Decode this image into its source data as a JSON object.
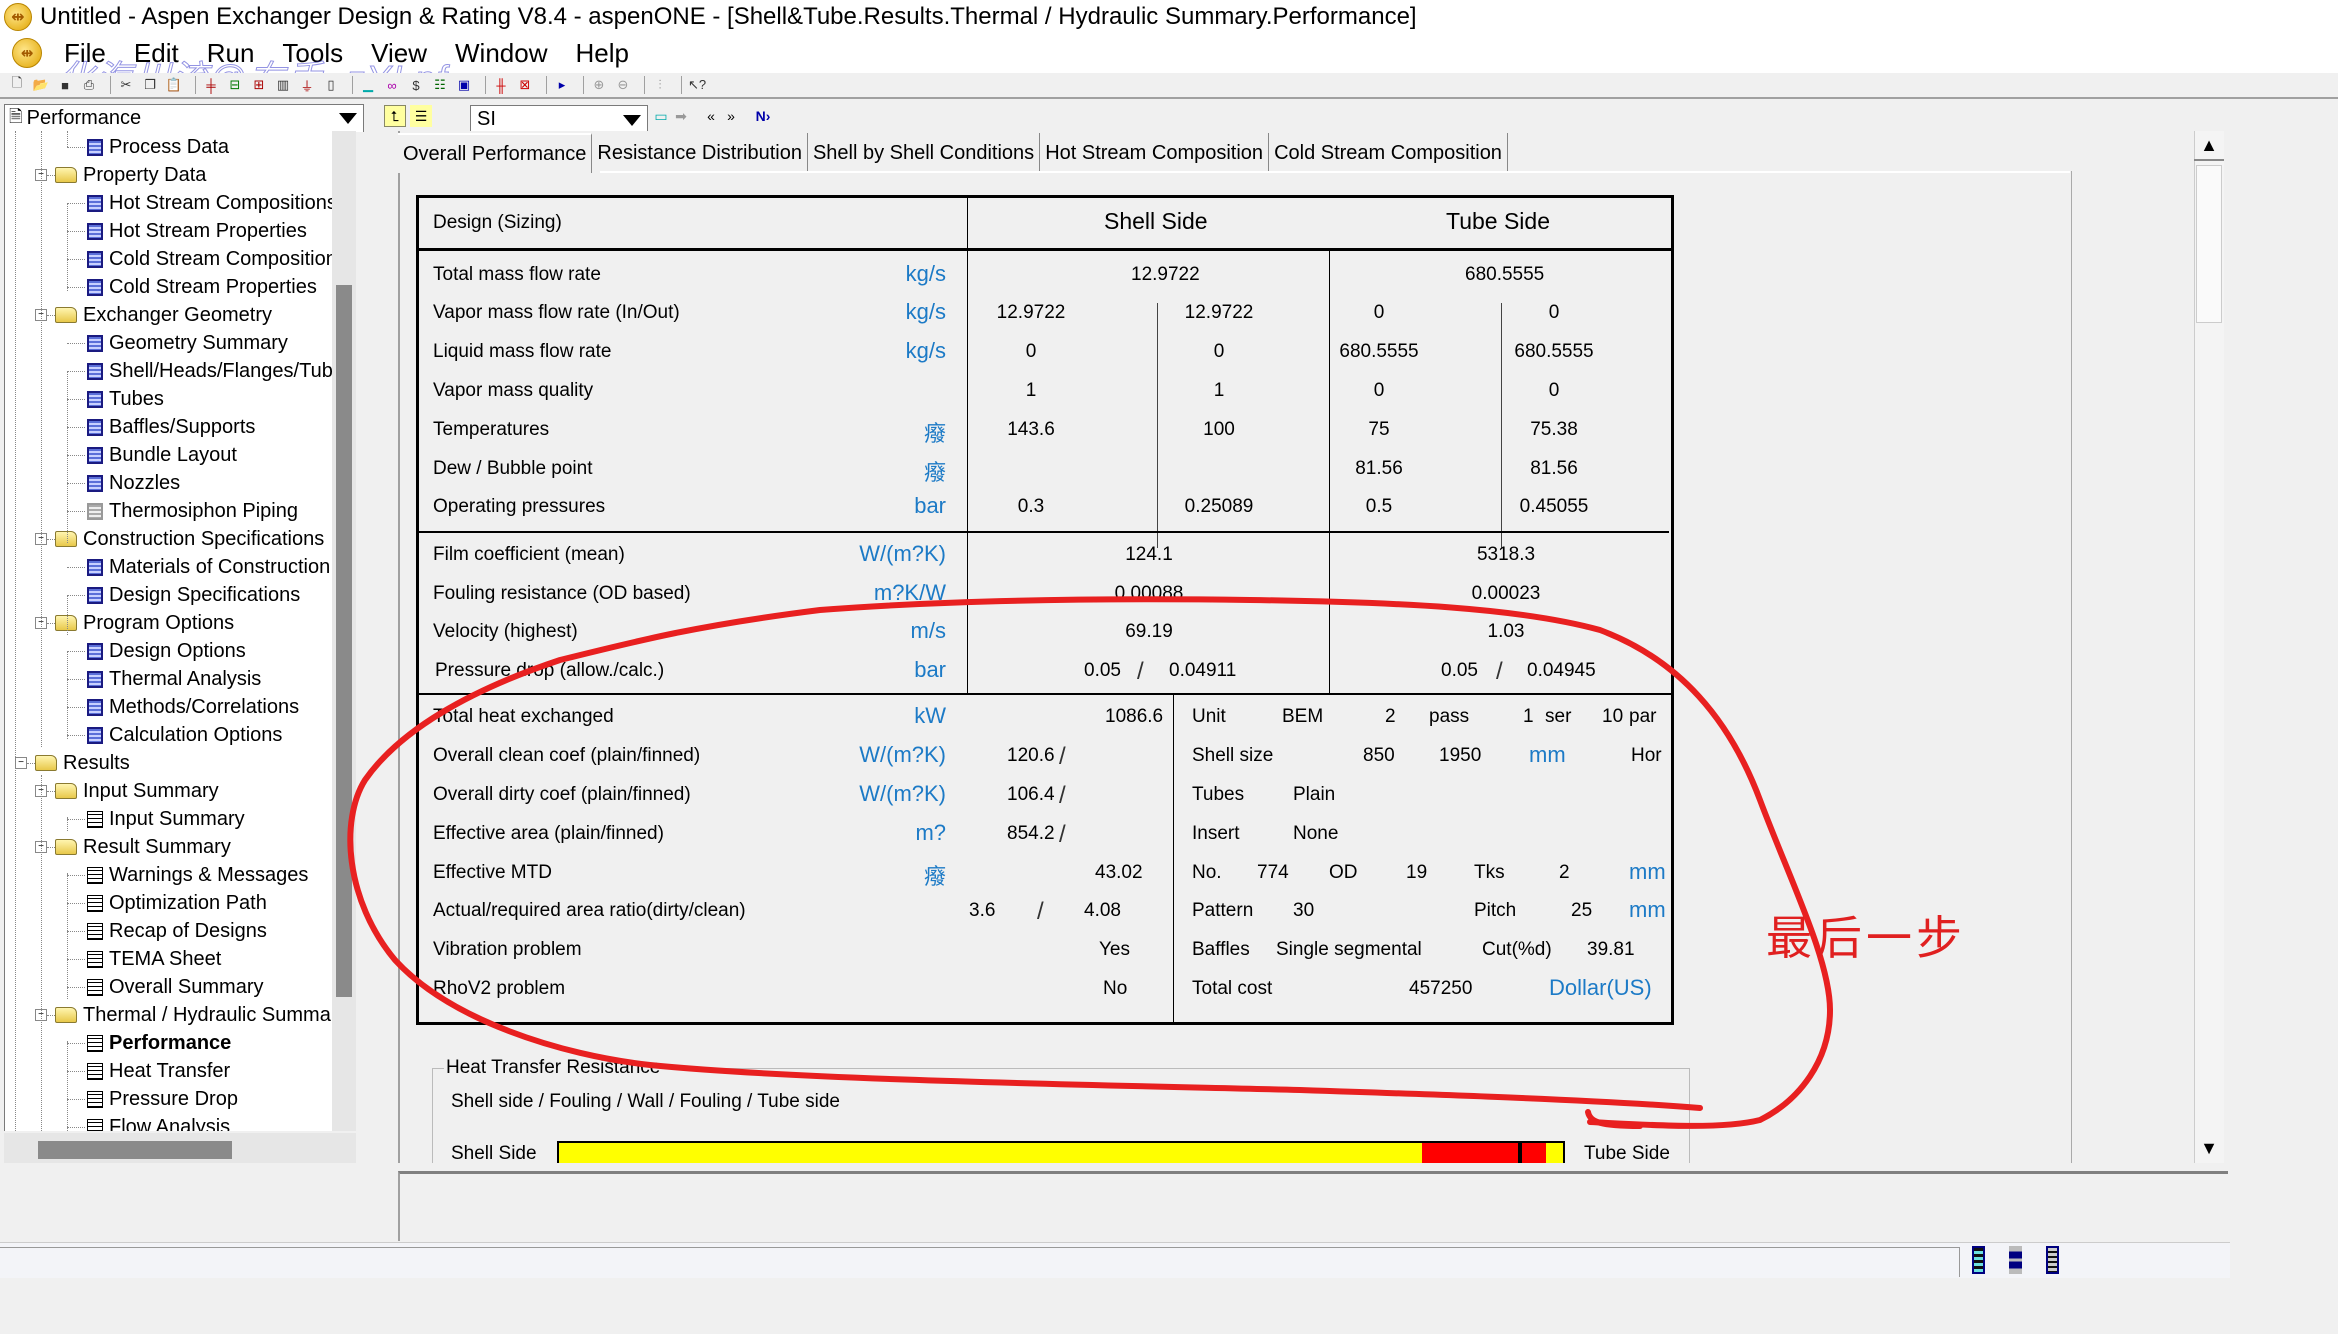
{
  "window": {
    "title": "Untitled - Aspen Exchanger Design & Rating V8.4 - aspenONE - [Shell&Tube.Results.Thermal / Hydraulic Summary.Performance]"
  },
  "menu": {
    "items": [
      "File",
      "Edit",
      "Run",
      "Tools",
      "View",
      "Window",
      "Help"
    ]
  },
  "watermark": "化海川流@右手_zYLnf",
  "toolbar": {
    "icons": [
      "new-file-icon",
      "open-folder-icon",
      "save-icon",
      "print-icon",
      "cut-icon",
      "copy-icon",
      "paste-icon",
      "exchanger-icon",
      "pump-icon",
      "column-icon",
      "reactor-icon",
      "vessel-icon",
      "drum-icon",
      "chart-icon",
      "bicycle-icon",
      "dollar-icon",
      "filter-icon",
      "calculator-icon",
      "exchanger-red-icon",
      "exchanger-red-2-icon",
      "run-icon",
      "zoom-in-icon",
      "zoom-out-icon",
      "graph-icon",
      "help-pointer-icon"
    ]
  },
  "nav": {
    "tree_select": "Performance",
    "units_select": "SI",
    "buttons": [
      "up-folder-icon",
      "tree-toggle-icon",
      "next-input-icon",
      "next-arrow-icon",
      "back-icon",
      "forward-icon",
      "next-required-icon"
    ]
  },
  "tree": {
    "items": [
      {
        "label": "Process Data",
        "level": 2,
        "icon": "form",
        "y": 0
      },
      {
        "label": "Property Data",
        "level": 1,
        "icon": "folder",
        "y": 1
      },
      {
        "label": "Hot Stream Compositions",
        "level": 2,
        "icon": "form",
        "y": 2
      },
      {
        "label": "Hot Stream Properties",
        "level": 2,
        "icon": "form",
        "y": 3
      },
      {
        "label": "Cold Stream Composition",
        "level": 2,
        "icon": "form",
        "y": 4
      },
      {
        "label": "Cold Stream Properties",
        "level": 2,
        "icon": "form",
        "y": 5
      },
      {
        "label": "Exchanger Geometry",
        "level": 1,
        "icon": "folder",
        "y": 6
      },
      {
        "label": "Geometry Summary",
        "level": 2,
        "icon": "form",
        "y": 7
      },
      {
        "label": "Shell/Heads/Flanges/Tub",
        "level": 2,
        "icon": "form",
        "y": 8
      },
      {
        "label": "Tubes",
        "level": 2,
        "icon": "form",
        "y": 9
      },
      {
        "label": "Baffles/Supports",
        "level": 2,
        "icon": "form",
        "y": 10
      },
      {
        "label": "Bundle Layout",
        "level": 2,
        "icon": "form",
        "y": 11
      },
      {
        "label": "Nozzles",
        "level": 2,
        "icon": "form",
        "y": 12
      },
      {
        "label": "Thermosiphon Piping",
        "level": 2,
        "icon": "form-disabled",
        "y": 13
      },
      {
        "label": "Construction Specifications",
        "level": 1,
        "icon": "folder",
        "y": 14
      },
      {
        "label": "Materials of Construction",
        "level": 2,
        "icon": "form",
        "y": 15
      },
      {
        "label": "Design Specifications",
        "level": 2,
        "icon": "form",
        "y": 16
      },
      {
        "label": "Program Options",
        "level": 1,
        "icon": "folder",
        "y": 17
      },
      {
        "label": "Design Options",
        "level": 2,
        "icon": "form",
        "y": 18
      },
      {
        "label": "Thermal Analysis",
        "level": 2,
        "icon": "form",
        "y": 19
      },
      {
        "label": "Methods/Correlations",
        "level": 2,
        "icon": "form",
        "y": 20
      },
      {
        "label": "Calculation Options",
        "level": 2,
        "icon": "form",
        "y": 21
      },
      {
        "label": "Results",
        "level": 0,
        "icon": "folder",
        "y": 22
      },
      {
        "label": "Input Summary",
        "level": 1,
        "icon": "folder",
        "y": 23
      },
      {
        "label": "Input Summary",
        "level": 2,
        "icon": "result",
        "y": 24
      },
      {
        "label": "Result Summary",
        "level": 1,
        "icon": "folder",
        "y": 25
      },
      {
        "label": "Warnings & Messages",
        "level": 2,
        "icon": "result",
        "y": 26
      },
      {
        "label": "Optimization Path",
        "level": 2,
        "icon": "result",
        "y": 27
      },
      {
        "label": "Recap of Designs",
        "level": 2,
        "icon": "result",
        "y": 28
      },
      {
        "label": "TEMA Sheet",
        "level": 2,
        "icon": "result",
        "y": 29
      },
      {
        "label": "Overall Summary",
        "level": 2,
        "icon": "result",
        "y": 30
      },
      {
        "label": "Thermal / Hydraulic Summar",
        "level": 1,
        "icon": "folder",
        "y": 31
      },
      {
        "label": "Performance",
        "level": 2,
        "icon": "result",
        "y": 32,
        "selected": true
      },
      {
        "label": "Heat Transfer",
        "level": 2,
        "icon": "result",
        "y": 33
      },
      {
        "label": "Pressure Drop",
        "level": 2,
        "icon": "result",
        "y": 34
      },
      {
        "label": "Flow Analysis",
        "level": 2,
        "icon": "result",
        "y": 35
      }
    ]
  },
  "tabs": [
    {
      "label": "Overall Performance",
      "active": true
    },
    {
      "label": "Resistance Distribution"
    },
    {
      "label": "Shell by Shell Conditions"
    },
    {
      "label": "Hot Stream Composition"
    },
    {
      "label": "Cold Stream Composition"
    }
  ],
  "table": {
    "header": {
      "design_label": "Design (Sizing)",
      "shell_side": "Shell Side",
      "tube_side": "Tube Side"
    },
    "section1": [
      {
        "label": "Total mass flow rate",
        "unit": "kg/s",
        "shell": "12.9722",
        "tube": "680.5555"
      },
      {
        "label": "Vapor mass flow rate  (In/Out)",
        "unit": "kg/s",
        "shell_in": "12.9722",
        "shell_out": "12.9722",
        "tube_in": "0",
        "tube_out": "0"
      },
      {
        "label": "Liquid mass flow rate",
        "unit": "kg/s",
        "shell_in": "0",
        "shell_out": "0",
        "tube_in": "680.5555",
        "tube_out": "680.5555"
      },
      {
        "label": "Vapor mass quality",
        "unit": "",
        "shell_in": "1",
        "shell_out": "1",
        "tube_in": "0",
        "tube_out": "0"
      },
      {
        "label": "Temperatures",
        "unit": "癈",
        "shell_in": "143.6",
        "shell_out": "100",
        "tube_in": "75",
        "tube_out": "75.38"
      },
      {
        "label": "Dew / Bubble point",
        "unit": "癈",
        "shell_in": "",
        "shell_out": "",
        "tube_in": "81.56",
        "tube_out": "81.56"
      },
      {
        "label": "Operating pressures",
        "unit": "bar",
        "shell_in": "0.3",
        "shell_out": "0.25089",
        "tube_in": "0.5",
        "tube_out": "0.45055"
      }
    ],
    "section2": [
      {
        "label": "Film coefficient (mean)",
        "unit": "W/(m?K)",
        "shell": "124.1",
        "tube": "5318.3"
      },
      {
        "label": "Fouling resistance (OD based)",
        "unit": "m?K/W",
        "shell": "0.00088",
        "tube": "0.00023"
      },
      {
        "label": "Velocity (highest)",
        "unit": "m/s",
        "shell": "69.19",
        "tube": "1.03"
      },
      {
        "label": "Pressure drop (allow./calc.)",
        "unit": "bar",
        "shell_allow": "0.05",
        "shell_calc": "0.04911",
        "tube_allow": "0.05",
        "tube_calc": "0.04945"
      }
    ],
    "section3_left": [
      {
        "label": "Total heat exchanged",
        "unit": "kW",
        "value": "1086.6"
      },
      {
        "label": "Overall clean coef (plain/finned)",
        "unit": "W/(m?K)",
        "value": "120.6"
      },
      {
        "label": "Overall dirty coef (plain/finned)",
        "unit": "W/(m?K)",
        "value": "106.4"
      },
      {
        "label": "Effective area (plain/finned)",
        "unit": "m?",
        "value": "854.2"
      },
      {
        "label": "Effective MTD",
        "unit": "癈",
        "value": "43.02"
      },
      {
        "label": "Actual/required area ratio(dirty/clean)",
        "unit": "",
        "value_a": "3.6",
        "value_b": "4.08"
      },
      {
        "label": "Vibration problem",
        "unit": "",
        "value": "Yes"
      },
      {
        "label": "RhoV2 problem",
        "unit": "",
        "value": "No"
      }
    ],
    "section3_right": {
      "unit_label": "Unit",
      "unit_type": "BEM",
      "passes": "2",
      "pass_label": "pass",
      "series": "1",
      "ser_label": "ser",
      "parallel": "10",
      "par_label": "par",
      "shell_size_label": "Shell size",
      "shell_dia": "850",
      "shell_len": "1950",
      "shell_unit": "mm",
      "orientation": "Hor",
      "tubes_label": "Tubes",
      "tubes_type": "Plain",
      "insert_label": "Insert",
      "insert_value": "None",
      "no_label": "No.",
      "no_value": "774",
      "od_label": "OD",
      "od_value": "19",
      "tks_label": "Tks",
      "tks_value": "2",
      "tube_unit": "mm",
      "pattern_label": "Pattern",
      "pattern_value": "30",
      "pitch_label": "Pitch",
      "pitch_value": "25",
      "pitch_unit": "mm",
      "baffles_label": "Baffles",
      "baffles_value": "Single segmental",
      "cut_label": "Cut(%d)",
      "cut_value": "39.81",
      "cost_label": "Total cost",
      "cost_value": "457250",
      "cost_unit": "Dollar(US)"
    }
  },
  "heat_transfer_resistance": {
    "title": "Heat Transfer Resistance",
    "subtitle": "Shell side / Fouling / Wall / Fouling / Tube side",
    "shell_label": "Shell Side",
    "tube_label": "Tube Side",
    "segments": [
      {
        "name": "shell-side",
        "fraction": 0.86,
        "color": "#ffff00"
      },
      {
        "name": "shell-fouling",
        "fraction": 0.095,
        "color": "#ff0000"
      },
      {
        "name": "wall",
        "fraction": 0.004,
        "color": "#000000"
      },
      {
        "name": "tube-fouling",
        "fraction": 0.024,
        "color": "#ff0000"
      },
      {
        "name": "tube-side",
        "fraction": 0.017,
        "color": "#ffff00"
      }
    ]
  },
  "annotation": {
    "text": "最后一步",
    "color": "#e02020"
  },
  "colors": {
    "unit_blue": "#1c7ac6",
    "annotation_red": "#e02020"
  }
}
